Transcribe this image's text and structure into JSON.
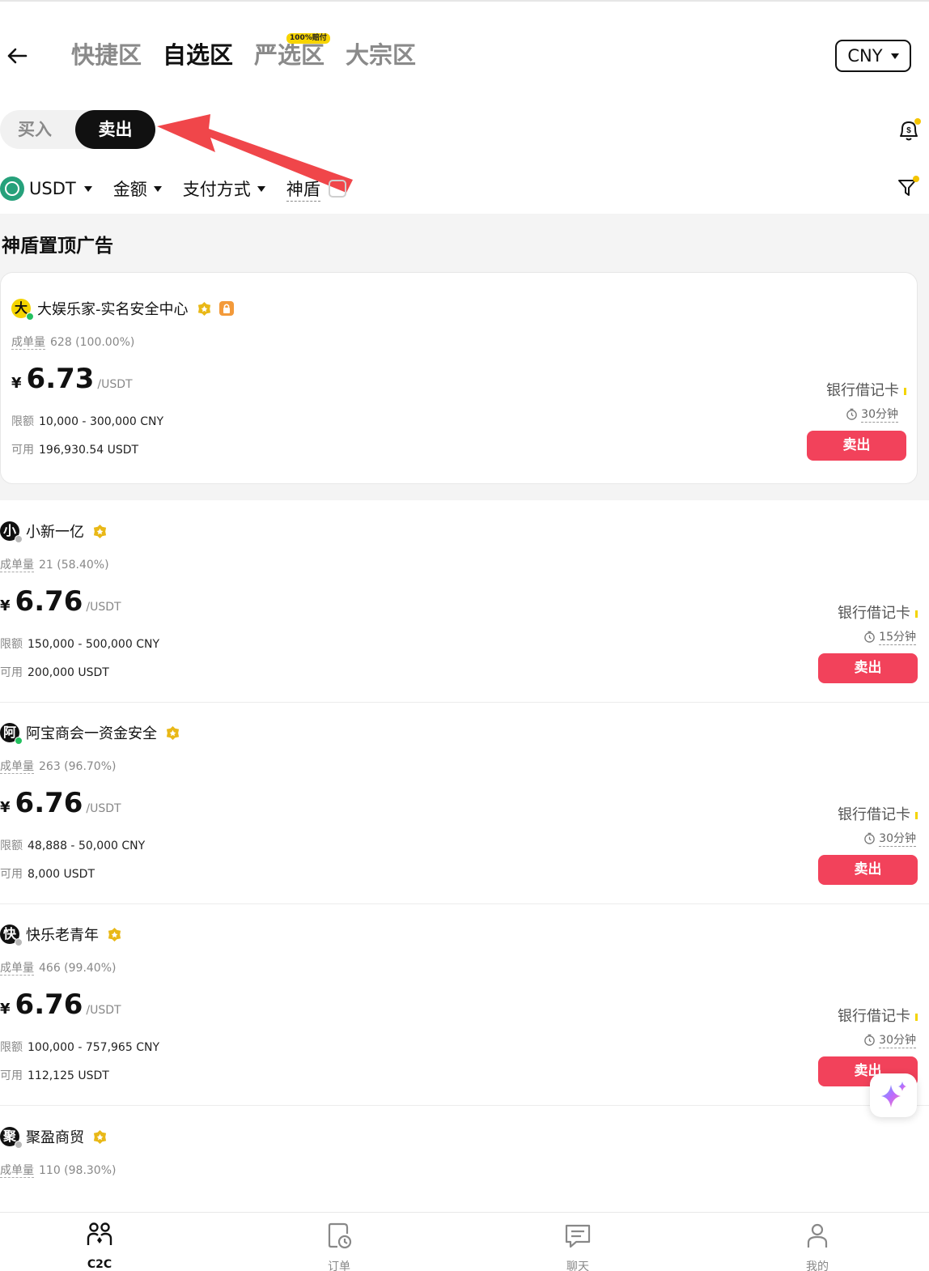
{
  "header": {
    "tabs": [
      {
        "label": "快捷区",
        "active": false
      },
      {
        "label": "自选区",
        "active": true
      },
      {
        "label": "严选区",
        "active": false,
        "badge": "100%赔付"
      },
      {
        "label": "大宗区",
        "active": false
      }
    ],
    "currency": "CNY"
  },
  "trade_toggle": {
    "buy": "买入",
    "sell": "卖出",
    "selected": "sell"
  },
  "filters": {
    "coin": "USDT",
    "amount": "金额",
    "payment": "支付方式",
    "shield": "神盾",
    "shield_checked": false
  },
  "section_title": "神盾置顶广告",
  "ads": [
    {
      "merchant": "大娱乐家-实名安全中心",
      "avatar": "大",
      "online": true,
      "stats_label": "成单量",
      "stats": "628 (100.00%)",
      "currency_symbol": "¥",
      "price": "6.73",
      "unit": "/USDT",
      "limit_label": "限额",
      "limit": "10,000 - 300,000 CNY",
      "avail_label": "可用",
      "available": "196,930.54 USDT",
      "payment": "银行借记卡",
      "time": "30分钟",
      "action": "卖出"
    },
    {
      "merchant": "小新一亿",
      "avatar": "小",
      "online": false,
      "stats_label": "成单量",
      "stats": "21 (58.40%)",
      "currency_symbol": "¥",
      "price": "6.76",
      "unit": "/USDT",
      "limit_label": "限额",
      "limit": "150,000 - 500,000 CNY",
      "avail_label": "可用",
      "available": "200,000 USDT",
      "payment": "银行借记卡",
      "time": "15分钟",
      "action": "卖出"
    },
    {
      "merchant": "阿宝商会一资金安全",
      "avatar": "阿",
      "online": true,
      "stats_label": "成单量",
      "stats": "263 (96.70%)",
      "currency_symbol": "¥",
      "price": "6.76",
      "unit": "/USDT",
      "limit_label": "限额",
      "limit": "48,888 - 50,000 CNY",
      "avail_label": "可用",
      "available": "8,000 USDT",
      "payment": "银行借记卡",
      "time": "30分钟",
      "action": "卖出"
    },
    {
      "merchant": "快乐老青年",
      "avatar": "快",
      "online": false,
      "stats_label": "成单量",
      "stats": "466 (99.40%)",
      "currency_symbol": "¥",
      "price": "6.76",
      "unit": "/USDT",
      "limit_label": "限额",
      "limit": "100,000 - 757,965 CNY",
      "avail_label": "可用",
      "available": "112,125 USDT",
      "payment": "银行借记卡",
      "time": "30分钟",
      "action": "卖出"
    },
    {
      "merchant": "聚盈商贸",
      "avatar": "聚",
      "online": false,
      "stats_label": "成单量",
      "stats": "110 (98.30%)"
    }
  ],
  "bottom_nav": [
    {
      "label": "C2C",
      "active": true
    },
    {
      "label": "订单",
      "active": false
    },
    {
      "label": "聊天",
      "active": false
    },
    {
      "label": "我的",
      "active": false
    }
  ]
}
